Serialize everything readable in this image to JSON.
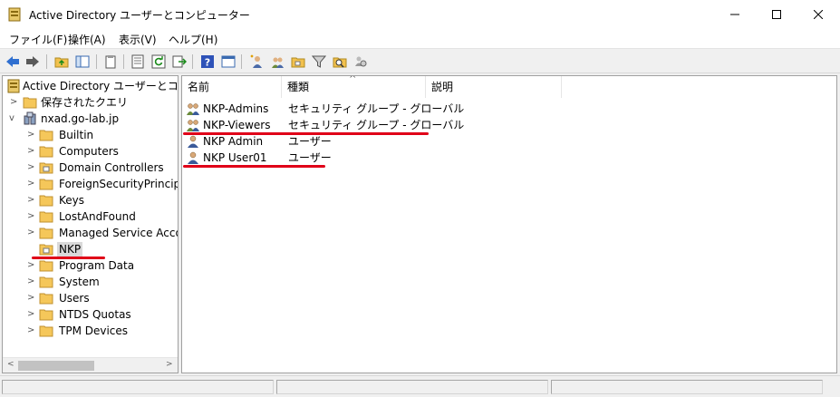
{
  "window": {
    "title": "Active Directory ユーザーとコンピューター"
  },
  "menu": [
    {
      "label": "ファイル(F)"
    },
    {
      "label": "操作(A)"
    },
    {
      "label": "表示(V)"
    },
    {
      "label": "ヘルプ(H)"
    }
  ],
  "tree": {
    "root": "Active Directory ユーザーとコンピュー",
    "saved_queries": "保存されたクエリ",
    "domain": "nxad.go-lab.jp",
    "children": [
      {
        "label": "Builtin"
      },
      {
        "label": "Computers"
      },
      {
        "label": "Domain Controllers"
      },
      {
        "label": "ForeignSecurityPrincipals"
      },
      {
        "label": "Keys"
      },
      {
        "label": "LostAndFound"
      },
      {
        "label": "Managed Service Accounts"
      },
      {
        "label": "NKP"
      },
      {
        "label": "Program Data"
      },
      {
        "label": "System"
      },
      {
        "label": "Users"
      },
      {
        "label": "NTDS Quotas"
      },
      {
        "label": "TPM Devices"
      }
    ]
  },
  "list": {
    "columns": [
      "名前",
      "種類",
      "説明"
    ],
    "rows": [
      {
        "name": "NKP-Admins",
        "type": "セキュリティ グループ - グローバル",
        "icon": "group-icon"
      },
      {
        "name": "NKP-Viewers",
        "type": "セキュリティ グループ - グローバル",
        "icon": "group-icon"
      },
      {
        "name": "NKP Admin",
        "type": "ユーザー",
        "icon": "user-icon"
      },
      {
        "name": "NKP User01",
        "type": "ユーザー",
        "icon": "user-icon"
      }
    ]
  },
  "colors": {
    "annotation": "#e00018",
    "folder": "#f5c75a"
  }
}
